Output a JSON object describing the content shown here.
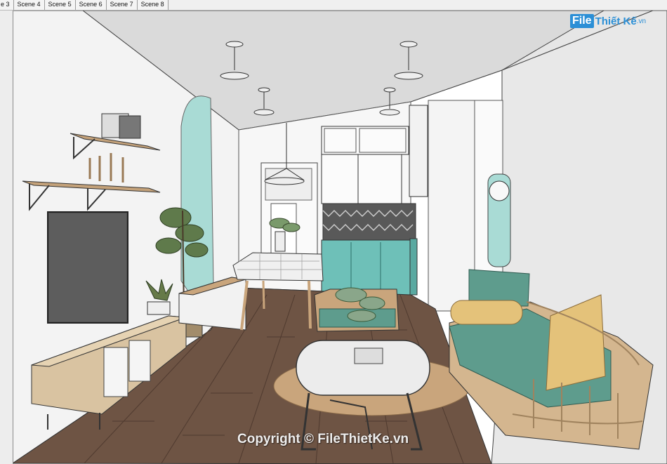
{
  "scene_tabs": [
    "e 3",
    "Scene 4",
    "Scene 5",
    "Scene 6",
    "Scene 7",
    "Scene 8"
  ],
  "logo": {
    "box": "File",
    "rest": "Thiết Kế",
    "suffix": ".vn"
  },
  "watermark": "Copyright © FileThietKe.vn",
  "colors": {
    "teal": "#9fd3cc",
    "sofa": "#5e9c8d",
    "floor": "#6b5142",
    "cushion": "#e4c27a",
    "wall": "#f4f4f4",
    "cabinet_teal": "#6ec0b8"
  }
}
